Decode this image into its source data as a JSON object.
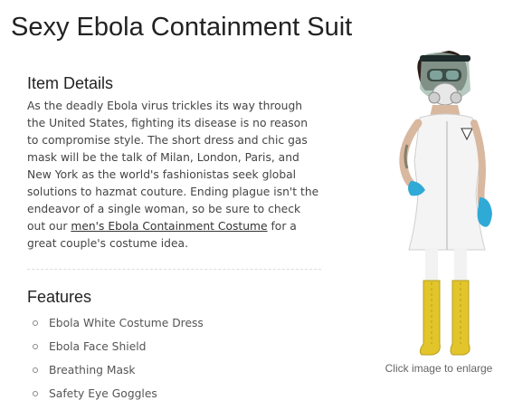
{
  "page": {
    "title": "Sexy Ebola Containment Suit"
  },
  "item_details": {
    "heading": "Item Details",
    "body_before_link": "As the deadly Ebola virus trickles its way through the United States, fighting its disease is no reason to compromise style. The short dress and chic gas mask will be the talk of Milan, London, Paris, and New York as the world's fashionistas seek global solutions to hazmat couture. Ending plague isn't the endeavor of a single woman, so be sure to check out our ",
    "link_text": "men's Ebola Containment Costume",
    "body_after_link": " for a great couple's costume idea."
  },
  "features": {
    "heading": "Features",
    "items": [
      "Ebola White Costume Dress",
      "Ebola Face Shield",
      "Breathing Mask",
      "Safety Eye Goggles"
    ]
  },
  "product_image": {
    "caption": "Click image to enlarge"
  },
  "colors": {
    "glove": "#2fa9d6",
    "boots": "#e2c52b",
    "dress": "#f7f7f7",
    "mask": "#5f8a7c"
  }
}
